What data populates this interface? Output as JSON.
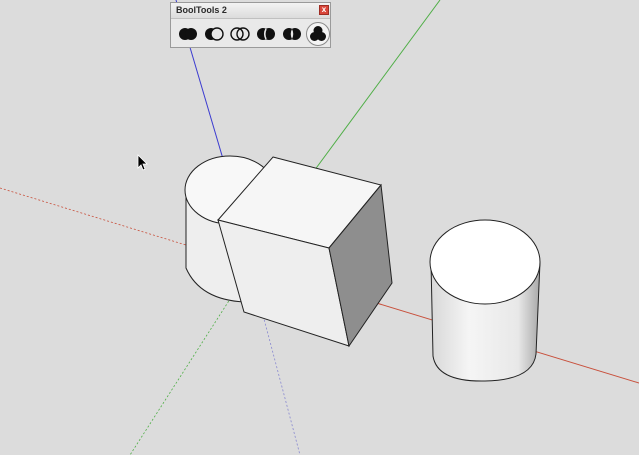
{
  "toolbar": {
    "title": "BoolTools 2",
    "close_label": "x",
    "tools": [
      {
        "name": "union",
        "icon": "union-icon"
      },
      {
        "name": "subtract",
        "icon": "subtract-icon"
      },
      {
        "name": "intersect",
        "icon": "intersect-icon"
      },
      {
        "name": "trim",
        "icon": "trim-icon"
      },
      {
        "name": "split",
        "icon": "split-icon"
      },
      {
        "name": "multi",
        "icon": "multi-boolean-icon",
        "active": true
      }
    ]
  },
  "colors": {
    "background": "#dcdcdc",
    "axis_red": "#c8503c",
    "axis_green": "#4fae46",
    "axis_blue": "#3b3bd0",
    "close_button": "#d9463a"
  }
}
